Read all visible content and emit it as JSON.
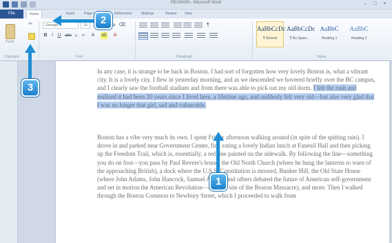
{
  "window": {
    "title": "REUNION - Microsoft Word",
    "controls": [
      "–",
      "□",
      "×"
    ]
  },
  "ribbon": {
    "file_tab": "File",
    "tabs": [
      "Home",
      "Insert",
      "Page Layout",
      "References",
      "Mailings",
      "Review",
      "View"
    ],
    "active_tab": "Home",
    "clipboard": {
      "paste_label": "Paste",
      "group_label": "Clipboard"
    },
    "font": {
      "name": "Georgia",
      "size": "10",
      "group_label": "Font"
    },
    "paragraph": {
      "group_label": "Paragraph"
    },
    "styles": {
      "group_label": "Styles",
      "items": [
        {
          "sample": "AaBbCcDc",
          "name": "¶ Normal"
        },
        {
          "sample": "AaBbCcDc",
          "name": "¶ No Spaci..."
        },
        {
          "sample": "AaBbC",
          "name": "Heading 1"
        },
        {
          "sample": "AaBbC",
          "name": "Heading 2"
        }
      ]
    }
  },
  "document": {
    "para1_before": "In any case, it is strange to be back in Boston. I had sort of forgotten how very lovely Boston is, what a vibrant city. It is a lovely city. I flew in yesterday morning, and as we descended we hovered briefly over the BC campus, and I clearly saw the football stadium and from there was able to pick out my old dorm. ",
    "para1_selected": "I felt the rush and realized it had been 20 years since I lived here, a lifetime ago, and suddenly felt very old—but also very glad that I was no longer that girl, sad and vulnerable.",
    "para2": "Boston has a vibe very much its own. I spent Friday afternoon walking around (in spite of the spitting rain). I drove in and parked near Government Center, first eating a lovely Indian lunch at Faneuil Hall and then picking up the Freedom Trail, which is, essentially, a red line painted on the sidewalk. By following the line—something you do on foot—you pass by Paul Revere's house, the Old North Church (where he hung the lanterns to warn of the approaching British), a dock where the U.S.S. Constitution is moored, Bunker Hill, the Old State House (where John Adams, John Hancock, Samuel Adams, and others debated the future of American self-government and set in motion the American Revolution—also the site of the Boston Massacre), and more. Then I walked through the Boston Common to Newbury Street, which I proceeded to walk from"
  },
  "callouts": {
    "one": "1",
    "two": "2",
    "three": "3"
  },
  "colors": {
    "accent": "#1e8fd6",
    "file_tab": "#2b5797",
    "selection": "#b5cdef"
  }
}
